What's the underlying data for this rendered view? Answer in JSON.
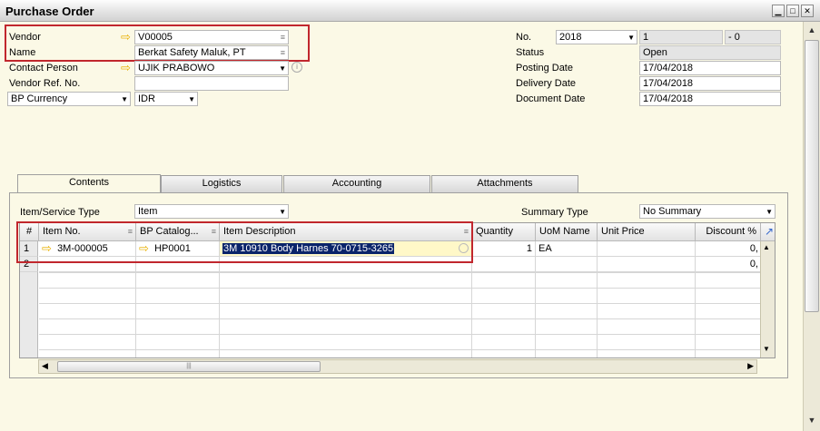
{
  "window": {
    "title": "Purchase Order"
  },
  "header_left": {
    "vendor_label": "Vendor",
    "vendor_value": "V00005",
    "name_label": "Name",
    "name_value": "Berkat Safety Maluk, PT",
    "contact_label": "Contact Person",
    "contact_value": "UJIK PRABOWO",
    "vendor_ref_label": "Vendor Ref. No.",
    "vendor_ref_value": "",
    "currency_label": "BP Currency",
    "currency_value": "IDR"
  },
  "header_right": {
    "no_label": "No.",
    "series_value": "2018",
    "doc_number": "1",
    "doc_suffix": "- 0",
    "status_label": "Status",
    "status_value": "Open",
    "posting_label": "Posting Date",
    "posting_value": "17/04/2018",
    "delivery_label": "Delivery Date",
    "delivery_value": "17/04/2018",
    "docdate_label": "Document Date",
    "docdate_value": "17/04/2018"
  },
  "tabs": [
    "Contents",
    "Logistics",
    "Accounting",
    "Attachments"
  ],
  "contents": {
    "service_type_label": "Item/Service Type",
    "service_type_value": "Item",
    "summary_type_label": "Summary Type",
    "summary_type_value": "No Summary"
  },
  "grid": {
    "columns": [
      "#",
      "Item No.",
      "BP Catalog...",
      "Item Description",
      "Quantity",
      "UoM Name",
      "Unit Price",
      "Discount %"
    ],
    "rows": [
      {
        "num": "1",
        "item_no": "3M-000005",
        "bp_catalog": "HP0001",
        "description": "3M 10910 Body Harnes 70-0715-3265",
        "quantity": "1",
        "uom": "EA",
        "unit_price": "",
        "discount": "0,"
      },
      {
        "num": "2",
        "item_no": "",
        "bp_catalog": "",
        "description": "",
        "quantity": "",
        "uom": "",
        "unit_price": "",
        "discount": "0,"
      }
    ]
  },
  "colors": {
    "highlight_box": "#c1272d",
    "selection": "#0a246a",
    "link_arrow": "#e8b000",
    "background": "#fbf9e6"
  }
}
